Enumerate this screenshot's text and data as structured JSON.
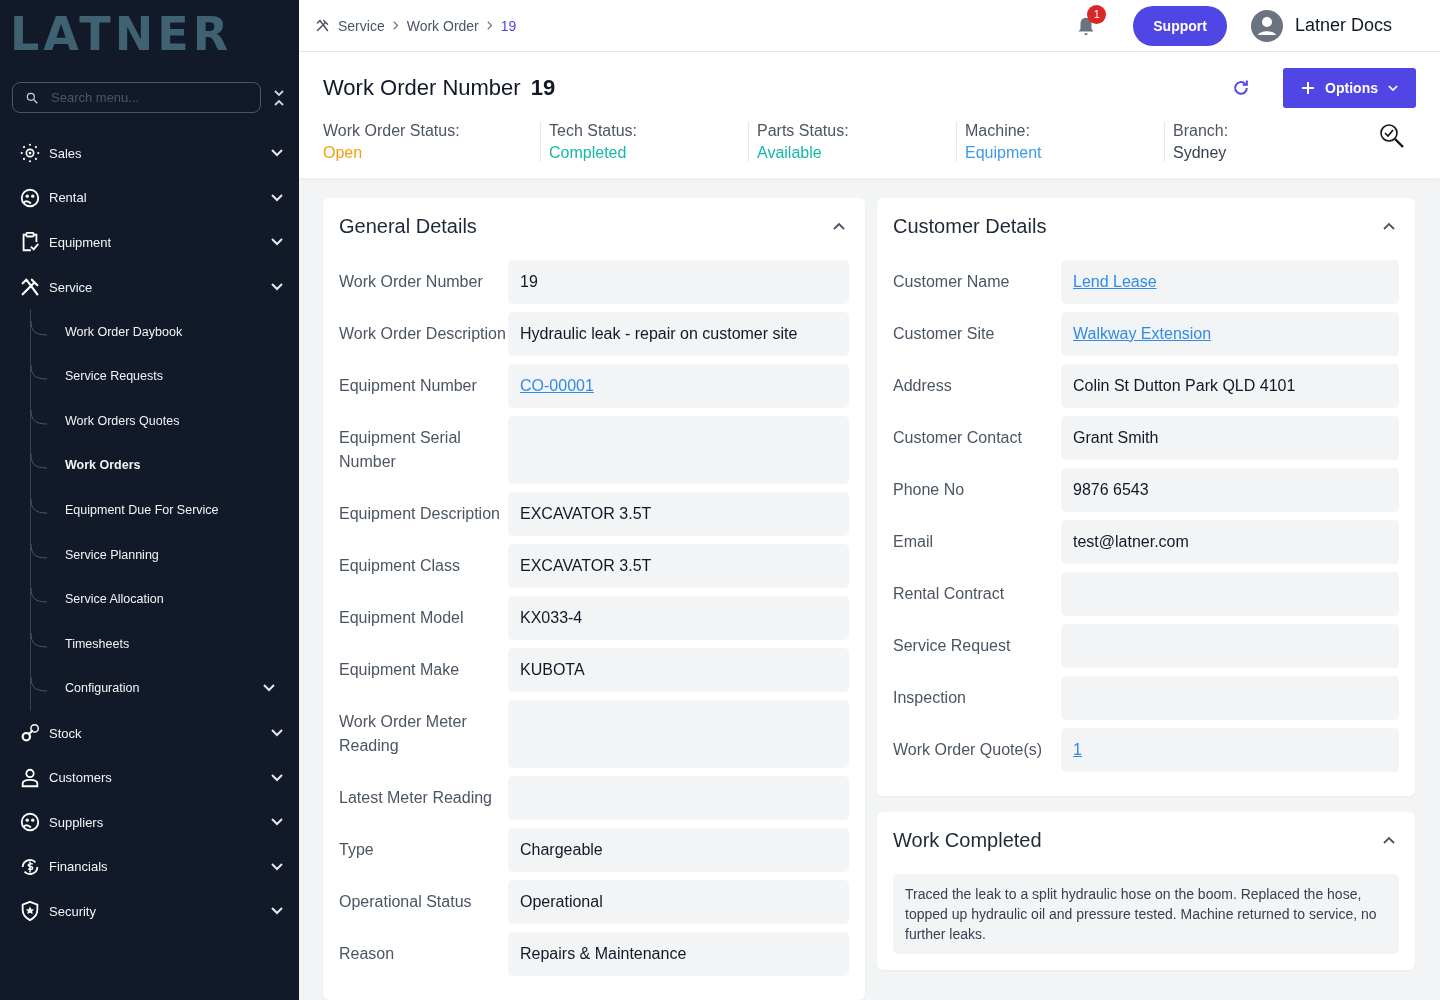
{
  "logo": "LATNER",
  "sidebar": {
    "search": {
      "placeholder": "Search menu..."
    },
    "items": [
      {
        "label": "Sales"
      },
      {
        "label": "Rental"
      },
      {
        "label": "Equipment"
      },
      {
        "label": "Service",
        "children": [
          {
            "label": "Work Order Daybook",
            "selected": false
          },
          {
            "label": "Service Requests",
            "selected": false
          },
          {
            "label": "Work Orders Quotes",
            "selected": false
          },
          {
            "label": "Work Orders",
            "selected": true
          },
          {
            "label": "Equipment Due For Service",
            "selected": false
          },
          {
            "label": "Service Planning",
            "selected": false
          },
          {
            "label": "Service Allocation",
            "selected": false
          },
          {
            "label": "Timesheets",
            "selected": false
          },
          {
            "label": "Configuration",
            "selected": false,
            "kind": "group"
          }
        ]
      },
      {
        "label": "Stock"
      },
      {
        "label": "Customers"
      },
      {
        "label": "Suppliers"
      },
      {
        "label": "Financials"
      },
      {
        "label": "Security"
      }
    ]
  },
  "breadcrumb": [
    "Service",
    "Work Order",
    "19"
  ],
  "notifications": {
    "count": "1"
  },
  "support_button": "Support",
  "user": {
    "name": "Latner Docs"
  },
  "header": {
    "title": "Work Order Number",
    "number": "19",
    "options_button": "Options",
    "statuses": [
      {
        "label": "Work Order Status:",
        "value": "Open",
        "color": "#f59e0b"
      },
      {
        "label": "Tech Status:",
        "value": "Completed",
        "color": "#14b8a6"
      },
      {
        "label": "Parts Status:",
        "value": "Available",
        "color": "#14b8a6"
      },
      {
        "label": "Machine:",
        "value": "Equipment",
        "color": "#3b9bec"
      },
      {
        "label": "Branch:",
        "value": "Sydney",
        "color": "#374151"
      }
    ]
  },
  "general_details": {
    "title": "General Details",
    "expanded": true,
    "fields": [
      {
        "label": "Work Order Number",
        "value": "19",
        "kind": "text"
      },
      {
        "label": "Work Order Description",
        "value": "Hydraulic leak - repair on customer site",
        "kind": "text"
      },
      {
        "label": "Equipment Number",
        "value": "CO-00001",
        "kind": "link"
      },
      {
        "label": "Equipment Serial Number",
        "kind": "text"
      },
      {
        "label": "Equipment Description",
        "value": "EXCAVATOR 3.5T",
        "kind": "text"
      },
      {
        "label": "Equipment Class",
        "value": "EXCAVATOR 3.5T",
        "kind": "text"
      },
      {
        "label": "Equipment Model",
        "value": "KX033-4",
        "kind": "text"
      },
      {
        "label": "Equipment Make",
        "value": "KUBOTA",
        "kind": "text"
      },
      {
        "label": "Work Order Meter Reading",
        "kind": "text"
      },
      {
        "label": "Latest Meter Reading",
        "kind": "text"
      },
      {
        "label": "Type",
        "value": "Chargeable",
        "kind": "text"
      },
      {
        "label": "Operational Status",
        "value": "Operational",
        "kind": "text"
      },
      {
        "label": "Reason",
        "value": "Repairs & Maintenance",
        "kind": "text"
      }
    ]
  },
  "customer_details": {
    "title": "Customer Details",
    "expanded": true,
    "fields": [
      {
        "label": "Customer Name",
        "value": "Lend Lease",
        "kind": "link"
      },
      {
        "label": "Customer Site",
        "value": "Walkway Extension",
        "kind": "link"
      },
      {
        "label": "Address",
        "value": "Colin St Dutton Park QLD 4101",
        "kind": "text"
      },
      {
        "label": "Customer Contact",
        "value": "Grant Smith",
        "kind": "text"
      },
      {
        "label": "Phone No",
        "value": "9876 6543",
        "kind": "text"
      },
      {
        "label": "Email",
        "value": "test@latner.com",
        "kind": "text"
      },
      {
        "label": "Rental Contract",
        "kind": "text"
      },
      {
        "label": "Service Request",
        "kind": "text"
      },
      {
        "label": "Inspection",
        "kind": "text"
      },
      {
        "label": "Work Order Quote(s)",
        "value": "1",
        "kind": "link"
      }
    ]
  },
  "work_completed": {
    "title": "Work Completed",
    "expanded": true,
    "text": "Traced the leak to a split hydraulic hose on the boom. Replaced the hose, topped up hydraulic oil and pressure tested. Machine returned to service, no further leaks."
  }
}
